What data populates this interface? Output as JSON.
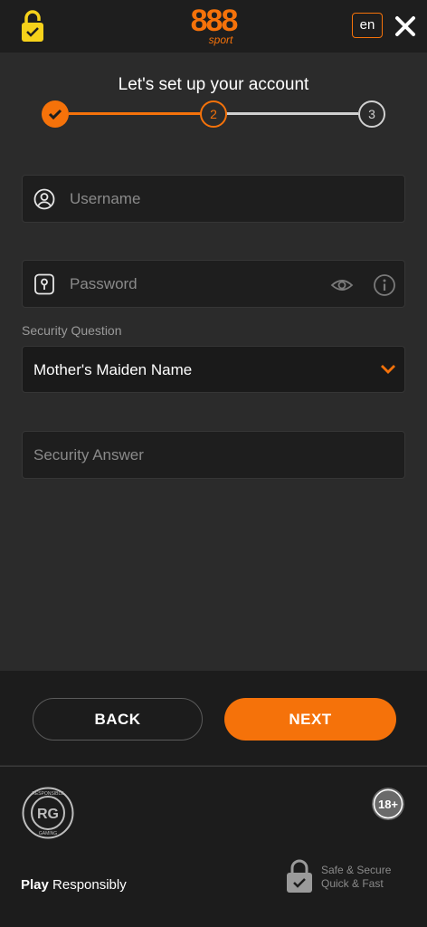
{
  "header": {
    "logo_number": "888",
    "logo_sub": "sport",
    "language": "en"
  },
  "page": {
    "title": "Let's set up your account"
  },
  "stepper": {
    "steps": [
      "1",
      "2",
      "3"
    ],
    "current_step": 2,
    "completed_steps": 1
  },
  "form": {
    "username_placeholder": "Username",
    "password_placeholder": "Password",
    "security_question_label": "Security Question",
    "security_question_value": "Mother's Maiden Name",
    "security_answer_placeholder": "Security Answer"
  },
  "actions": {
    "back_label": "BACK",
    "next_label": "NEXT"
  },
  "footer": {
    "rg_badge_text": "RG",
    "rg_badge_ring_top": "RESPONSIBLE",
    "rg_badge_ring_bottom": "GAMING",
    "age_badge": "18+",
    "play_bold": "Play",
    "play_rest": " Responsibly",
    "secure_line1": "Safe & Secure",
    "secure_line2": "Quick & Fast"
  },
  "colors": {
    "accent": "#f5720a",
    "background": "#2b2b2b",
    "field_bg": "#1e1e1e",
    "lock_icon": "#f6d21a"
  },
  "icons": {
    "lock": "lock-icon",
    "close": "close-icon",
    "user": "user-icon",
    "keyhole": "keyhole-icon",
    "eye": "eye-icon",
    "info": "info-icon",
    "chevron": "chevron-down-icon",
    "check": "check-icon"
  }
}
